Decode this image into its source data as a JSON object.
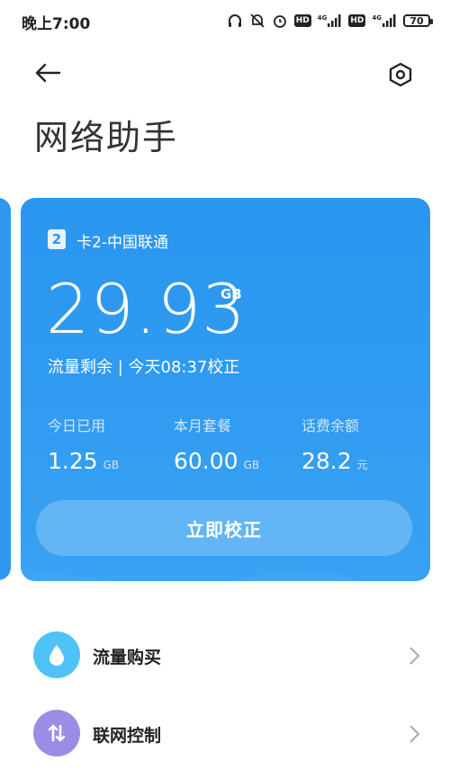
{
  "status_bar": {
    "time": "晚上7:00",
    "net1": "4G",
    "net2": "4G",
    "hd1": "HD",
    "hd2": "HD",
    "battery": "70"
  },
  "header": {
    "title": "网络助手",
    "back_icon": "arrow-left-icon",
    "settings_icon": "hexagon-settings-icon"
  },
  "card": {
    "sim_number": "2",
    "sim_label": "卡2-中国联通",
    "remaining_value": "29.93",
    "remaining_unit": "GB",
    "remaining_label": "流量剩余 | 今天08:37校正",
    "stats": [
      {
        "label": "今日已用",
        "value": "1.25",
        "unit": "GB"
      },
      {
        "label": "本月套餐",
        "value": "60.00",
        "unit": "GB"
      },
      {
        "label": "话费余额",
        "value": "28.2",
        "unit": "元"
      }
    ],
    "calibrate_button": "立即校正",
    "colors": {
      "card": "#2a96ef",
      "card_light": "#3aa2f3"
    }
  },
  "menu": [
    {
      "label": "流量购买",
      "icon": "water-drop-icon",
      "color": "#4fc3f7"
    },
    {
      "label": "联网控制",
      "icon": "up-down-arrows-icon",
      "color": "#9c8ce6"
    }
  ]
}
